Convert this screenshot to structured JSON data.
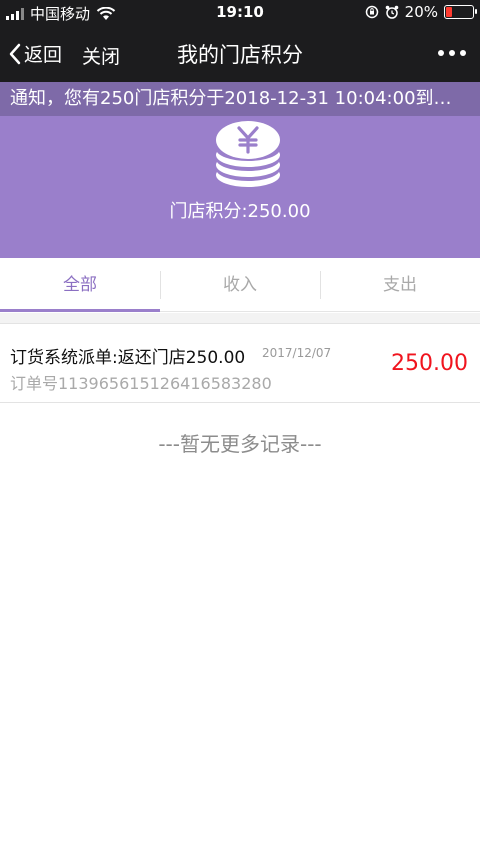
{
  "status_bar": {
    "carrier": "中国移动",
    "time": "19:10",
    "battery": "20%",
    "battery_level": 0.2,
    "battery_color": "#ff3b30"
  },
  "nav": {
    "back_label": "返回",
    "close_label": "关闭",
    "title": "我的门店积分",
    "more_icon": "more-dots-icon"
  },
  "notice": {
    "text": "通知，您有250门店积分于2018-12-31 10:04:00到…"
  },
  "header": {
    "icon": "coins-yen-icon",
    "points_label": "门店积分:250.00",
    "bg_color": "#9a7fcb"
  },
  "tabs": [
    {
      "label": "全部",
      "active": true
    },
    {
      "label": "收入",
      "active": false
    },
    {
      "label": "支出",
      "active": false
    }
  ],
  "records": [
    {
      "title": "订货系统派单:返还门店250.00",
      "date": "2017/12/07",
      "order": "订单号1139656151264165832​80",
      "amount": "250.00",
      "amount_color": "#f0141e"
    }
  ],
  "footer": {
    "no_more": "---暂无更多记录---"
  }
}
